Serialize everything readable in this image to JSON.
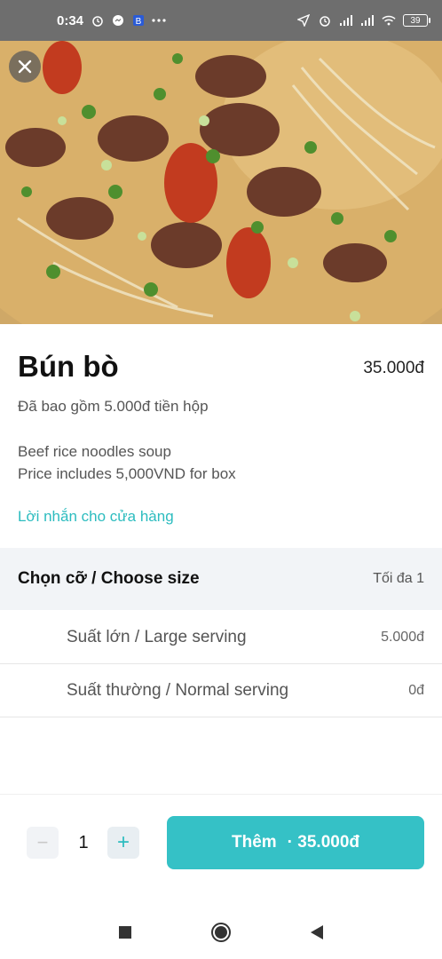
{
  "status_bar": {
    "time": "0:34",
    "battery": "39",
    "icons_left": [
      "alarm-icon",
      "messenger-icon",
      "app-icon",
      "more-icon"
    ],
    "icons_right": [
      "location-icon",
      "alarm-icon",
      "signal-icon",
      "signal-icon",
      "wifi-icon",
      "battery-icon"
    ]
  },
  "item": {
    "name": "Bún bò",
    "price": "35.000đ",
    "box_note": "Đã bao gồm 5.000đ tiền hộp",
    "description_line1": "Beef rice noodles soup",
    "description_line2": "Price includes 5,000VND for box",
    "message_link": "Lời nhắn cho cửa hàng"
  },
  "size_section": {
    "title": "Chọn cỡ / Choose size",
    "max_label": "Tối đa 1",
    "options": [
      {
        "label": "Suất lớn / Large serving",
        "price": "5.000đ"
      },
      {
        "label": "Suất thường / Normal serving",
        "price": "0đ"
      }
    ]
  },
  "footer": {
    "quantity": "1",
    "minus_label": "−",
    "plus_label": "+",
    "add_label": "Thêm",
    "add_price": "· 35.000đ"
  },
  "colors": {
    "accent": "#35c1c6",
    "link": "#2cbcbf",
    "status_bar": "#6e6e6e",
    "section_bg": "#f2f4f7"
  }
}
